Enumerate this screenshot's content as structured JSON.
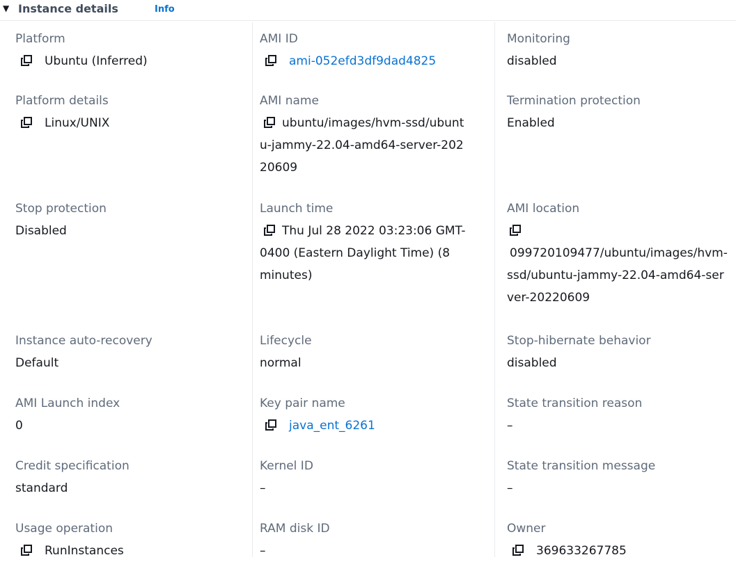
{
  "header": {
    "caret": "▼",
    "title": "Instance details",
    "info_link": "Info"
  },
  "columns": [
    {
      "fields": [
        {
          "label": "Platform",
          "value": "Ubuntu (Inferred)",
          "copy": true,
          "link": false
        },
        {
          "label": "Platform details",
          "value": "Linux/UNIX",
          "copy": true,
          "link": false
        },
        {
          "label": "Stop protection",
          "value": "Disabled",
          "copy": false,
          "link": false
        },
        {
          "label": "Instance auto-recovery",
          "value": "Default",
          "copy": false,
          "link": false
        },
        {
          "label": "AMI Launch index",
          "value": "0",
          "copy": false,
          "link": false
        },
        {
          "label": "Credit specification",
          "value": "standard",
          "copy": false,
          "link": false
        },
        {
          "label": "Usage operation",
          "value": "RunInstances",
          "copy": true,
          "link": false
        }
      ]
    },
    {
      "fields": [
        {
          "label": "AMI ID",
          "value": "ami-052efd3df9dad4825",
          "copy": true,
          "link": true
        },
        {
          "label": "AMI name",
          "value": "ubuntu/images/hvm-ssd/ubuntu-jammy-22.04-amd64-server-20220609",
          "copy": true,
          "link": false
        },
        {
          "label": "Launch time",
          "value": "Thu Jul 28 2022 03:23:06 GMT-0400 (Eastern Daylight Time) (8 minutes)",
          "copy": true,
          "link": false
        },
        {
          "label": "Lifecycle",
          "value": "normal",
          "copy": false,
          "link": false
        },
        {
          "label": "Key pair name",
          "value": "java_ent_6261",
          "copy": true,
          "link": true
        },
        {
          "label": "Kernel ID",
          "value": "–",
          "copy": false,
          "link": false
        },
        {
          "label": "RAM disk ID",
          "value": "–",
          "copy": false,
          "link": false
        }
      ]
    },
    {
      "fields": [
        {
          "label": "Monitoring",
          "value": "disabled",
          "copy": false,
          "link": false
        },
        {
          "label": "Termination protection",
          "value": "Enabled",
          "copy": false,
          "link": false
        },
        {
          "label": "AMI location",
          "value": "099720109477/ubuntu/images/hvm-ssd/ubuntu-jammy-22.04-amd64-server-20220609",
          "copy": true,
          "link": false
        },
        {
          "label": "Stop-hibernate behavior",
          "value": "disabled",
          "copy": false,
          "link": false
        },
        {
          "label": "State transition reason",
          "value": "–",
          "copy": false,
          "link": false
        },
        {
          "label": "State transition message",
          "value": "–",
          "copy": false,
          "link": false
        },
        {
          "label": "Owner",
          "value": "369633267785",
          "copy": true,
          "link": false
        }
      ]
    }
  ]
}
